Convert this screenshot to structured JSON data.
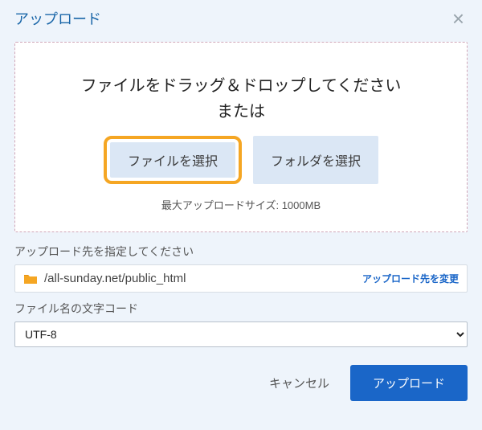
{
  "dialog": {
    "title": "アップロード"
  },
  "dropzone": {
    "line1": "ファイルをドラッグ＆ドロップしてください",
    "line2": "または",
    "select_file": "ファイルを選択",
    "select_folder": "フォルダを選択",
    "max_size": "最大アップロードサイズ: 1000MB"
  },
  "destination": {
    "label": "アップロード先を指定してください",
    "path": "/all-sunday.net/public_html",
    "change": "アップロード先を変更"
  },
  "encoding": {
    "label": "ファイル名の文字コード",
    "value": "UTF-8"
  },
  "footer": {
    "cancel": "キャンセル",
    "upload": "アップロード"
  }
}
